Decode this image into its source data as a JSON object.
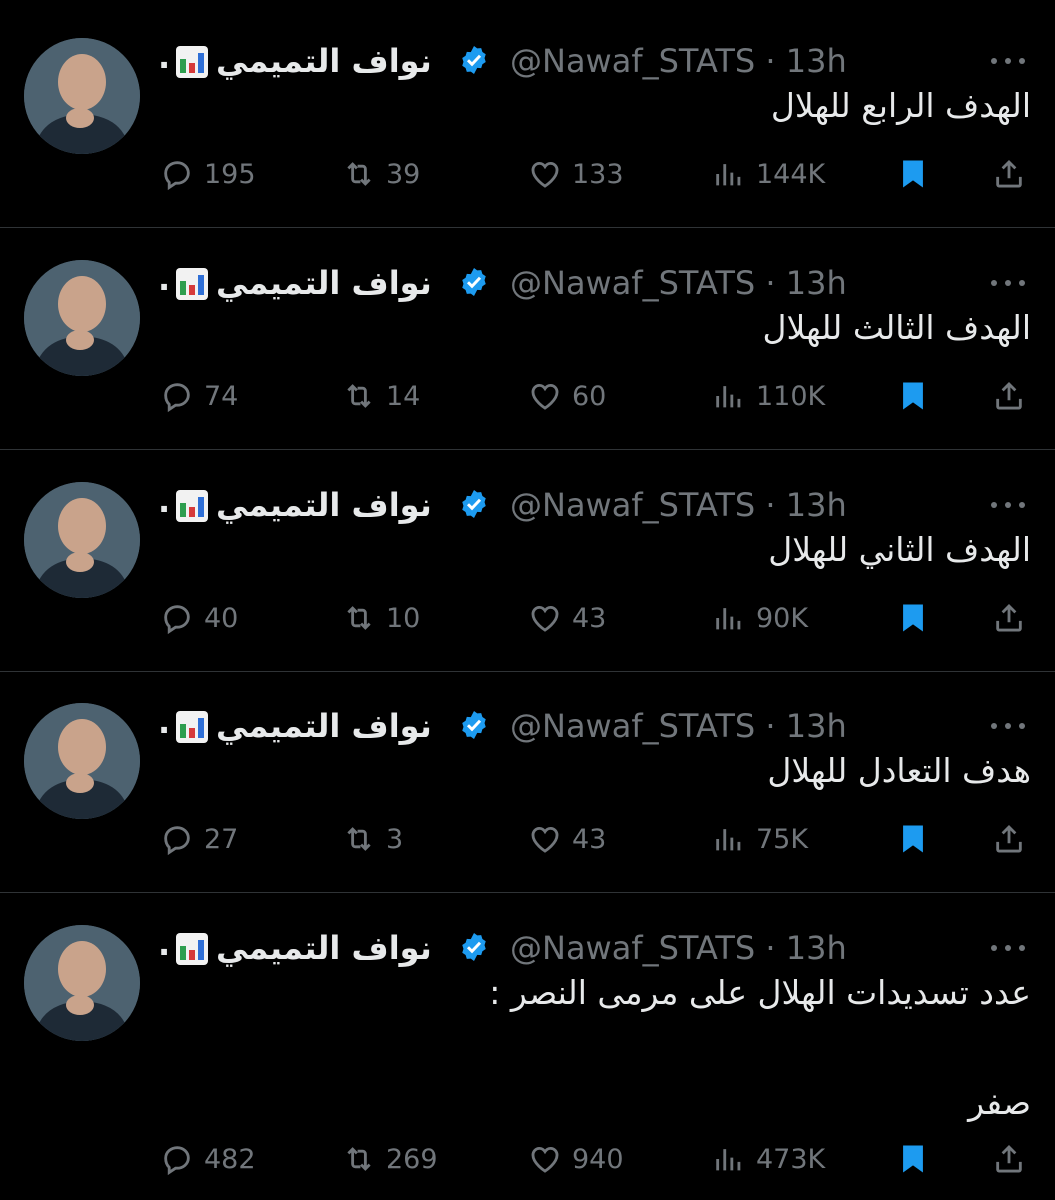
{
  "accent_color": "#1d9bf0",
  "tweets": [
    {
      "display_name": "نواف التميمي",
      "name_prefix": ".",
      "handle": "@Nawaf_STATS",
      "separator": "·",
      "time": "13h",
      "text": "الهدف الرابع للهلال",
      "replies": "195",
      "reposts": "39",
      "likes": "133",
      "views": "144K",
      "bookmarked": true
    },
    {
      "display_name": "نواف التميمي",
      "name_prefix": ".",
      "handle": "@Nawaf_STATS",
      "separator": "·",
      "time": "13h",
      "text": "الهدف الثالث للهلال",
      "replies": "74",
      "reposts": "14",
      "likes": "60",
      "views": "110K",
      "bookmarked": true
    },
    {
      "display_name": "نواف التميمي",
      "name_prefix": ".",
      "handle": "@Nawaf_STATS",
      "separator": "·",
      "time": "13h",
      "text": "الهدف الثاني للهلال",
      "replies": "40",
      "reposts": "10",
      "likes": "43",
      "views": "90K",
      "bookmarked": true
    },
    {
      "display_name": "نواف التميمي",
      "name_prefix": ".",
      "handle": "@Nawaf_STATS",
      "separator": "·",
      "time": "13h",
      "text": "هدف التعادل للهلال",
      "replies": "27",
      "reposts": "3",
      "likes": "43",
      "views": "75K",
      "bookmarked": true
    },
    {
      "display_name": "نواف التميمي",
      "name_prefix": ".",
      "handle": "@Nawaf_STATS",
      "separator": "·",
      "time": "13h",
      "text": "عدد تسديدات الهلال على مرمى النصر :",
      "text_line2": "صفر",
      "replies": "482",
      "reposts": "269",
      "likes": "940",
      "views": "473K",
      "bookmarked": true
    }
  ]
}
